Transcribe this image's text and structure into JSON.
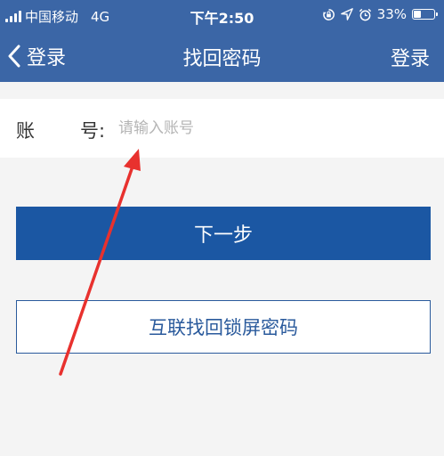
{
  "status_bar": {
    "carrier": "中国移动",
    "network": "4G",
    "time": "下午2:50",
    "battery_percent": "33%",
    "battery_level": 0.33,
    "icons": [
      "signal-icon",
      "rotation-lock-icon",
      "location-icon",
      "alarm-icon",
      "battery-icon"
    ]
  },
  "nav": {
    "back_label": "登录",
    "title": "找回密码",
    "right_label": "登录"
  },
  "form": {
    "account_label_1": "账",
    "account_label_2": "号:",
    "account_value": "",
    "account_placeholder": "请输入账号"
  },
  "buttons": {
    "next_label": "下一步",
    "hulian_label": "互联找回锁屏密码"
  },
  "colors": {
    "header_bg": "#3b66a6",
    "primary_button": "#1b57a3",
    "annotation_arrow": "#e8312e"
  }
}
